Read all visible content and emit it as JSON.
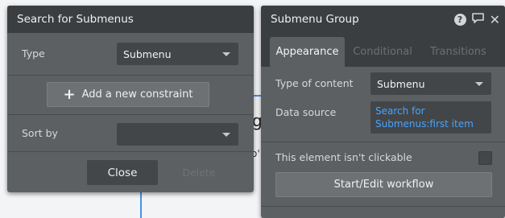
{
  "search_panel": {
    "title": "Search for Submenus",
    "type_label": "Type",
    "type_value": "Submenu",
    "add_constraint_label": "Add a new constraint",
    "sort_by_label": "Sort by",
    "sort_by_value": "",
    "close_label": "Close",
    "delete_label": "Delete"
  },
  "submenu_panel": {
    "title": "Submenu Group",
    "tabs": [
      {
        "label": "Appearance"
      },
      {
        "label": "Conditional"
      },
      {
        "label": "Transitions"
      }
    ],
    "type_of_content_label": "Type of content",
    "type_of_content_value": "Submenu",
    "data_source_label": "Data source",
    "data_source_value": "Search for Submenus:first item",
    "not_clickable_label": "This element isn't clickable",
    "not_clickable_checked": false,
    "workflow_label": "Start/Edit workflow"
  },
  "icons": {
    "help": "help-icon",
    "comment": "comment-icon",
    "close": "close-icon",
    "plus": "plus-icon"
  },
  "colors": {
    "panel_bg": "#5c6063",
    "header_bg": "#3b3e40",
    "link": "#4aa3ff",
    "connector": "#4a90e2"
  },
  "background": {
    "glyph_g": "g",
    "glyph_o": "o'"
  }
}
